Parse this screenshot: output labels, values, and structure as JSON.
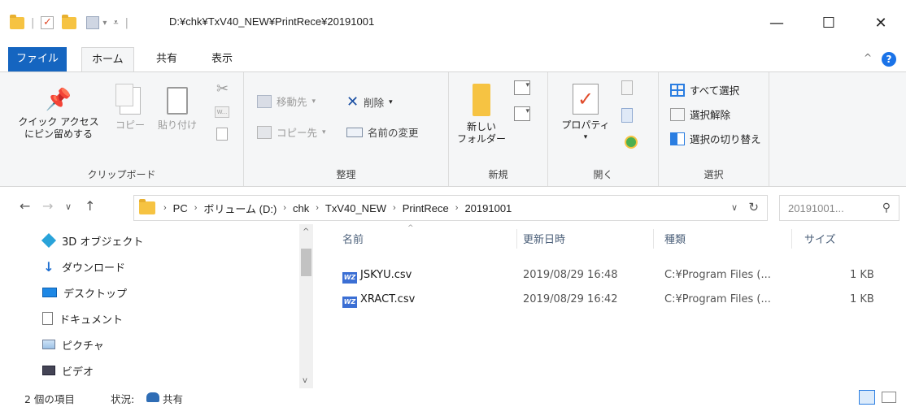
{
  "window": {
    "title_path": "D:¥chk¥TxV40_NEW¥PrintRece¥20191001",
    "minimize": "—",
    "maximize": "☐",
    "close": "✕"
  },
  "tabs": [
    {
      "label": "ファイル"
    },
    {
      "label": "ホーム"
    },
    {
      "label": "共有"
    },
    {
      "label": "表示"
    }
  ],
  "ribbon": {
    "clipboard": {
      "label": "クリップボード",
      "pin_line1": "クイック アクセス",
      "pin_line2": "にピン留めする",
      "copy": "コピー",
      "paste": "貼り付け"
    },
    "organize": {
      "label": "整理",
      "move_to": "移動先",
      "copy_to": "コピー先",
      "delete": "削除",
      "rename": "名前の変更"
    },
    "new": {
      "label": "新規",
      "new_folder_line1": "新しい",
      "new_folder_line2": "フォルダー"
    },
    "open": {
      "label": "開く",
      "properties": "プロパティ"
    },
    "select": {
      "label": "選択",
      "select_all": "すべて選択",
      "select_none": "選択解除",
      "invert": "選択の切り替え"
    }
  },
  "address": {
    "crumbs": [
      "PC",
      "ボリューム (D:)",
      "chk",
      "TxV40_NEW",
      "PrintRece",
      "20191001"
    ],
    "search_placeholder": "20191001..."
  },
  "navpane": {
    "items": [
      {
        "label": "3D オブジェクト",
        "icon": "cube-icon"
      },
      {
        "label": "ダウンロード",
        "icon": "download-icon"
      },
      {
        "label": "デスクトップ",
        "icon": "desktop-icon"
      },
      {
        "label": "ドキュメント",
        "icon": "document-icon"
      },
      {
        "label": "ピクチャ",
        "icon": "picture-icon"
      },
      {
        "label": "ビデオ",
        "icon": "video-icon"
      }
    ]
  },
  "filelist": {
    "columns": [
      "名前",
      "更新日時",
      "種類",
      "サイズ"
    ],
    "rows": [
      {
        "name": "JSKYU.csv",
        "modified": "2019/08/29 16:48",
        "type": "C:¥Program Files (...",
        "size": "1 KB"
      },
      {
        "name": "XRACT.csv",
        "modified": "2019/08/29 16:42",
        "type": "C:¥Program Files (...",
        "size": "1 KB"
      }
    ]
  },
  "status": {
    "item_count": "2 個の項目",
    "state_label": "状況:",
    "state_value": "共有"
  },
  "colors": {
    "file_tab": "#1565c0",
    "folder": "#f6c342",
    "accent_blue": "#0078d7"
  }
}
